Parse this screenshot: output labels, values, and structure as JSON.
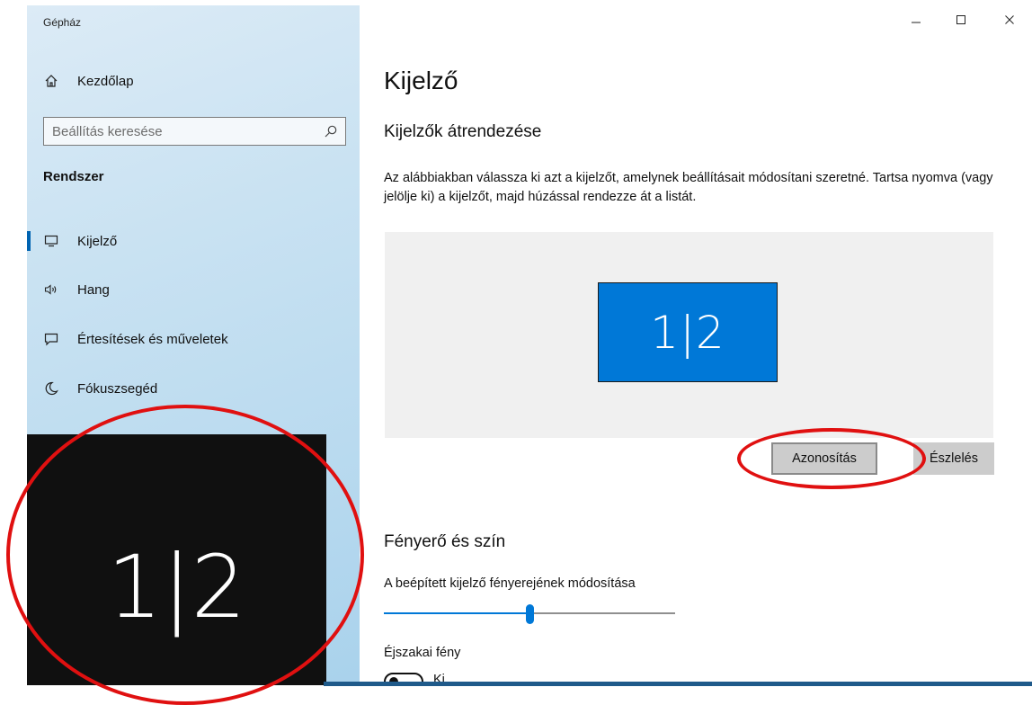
{
  "window": {
    "title": "Gépház",
    "controls": {
      "minimize": "–",
      "maximize": "☐",
      "close": "✕"
    }
  },
  "sidebar": {
    "home_label": "Kezdőlap",
    "search": {
      "placeholder": "Beállítás keresése",
      "value": ""
    },
    "section": "Rendszer",
    "items": [
      {
        "label": "Kijelző",
        "icon": "monitor-icon",
        "selected": true
      },
      {
        "label": "Hang",
        "icon": "speaker-icon"
      },
      {
        "label": "Értesítések és műveletek",
        "icon": "notification-icon"
      },
      {
        "label": "Fókuszsegéd",
        "icon": "moon-icon"
      }
    ]
  },
  "main": {
    "title": "Kijelző",
    "arrange": {
      "heading": "Kijelzők átrendezése",
      "description": "Az alábbiakban válassza ki azt a kijelzőt, amelynek beállításait módosítani szeretné. Tartsa nyomva (vagy jelölje ki) a kijelzőt, majd húzással rendezze át a listát.",
      "monitor_label": "1|2",
      "identify_button": "Azonosítás",
      "detect_button": "Észlelés"
    },
    "brightness": {
      "heading": "Fényerő és szín",
      "label": "A beépített kijelző fényerejének módosítása",
      "value": 0.5
    },
    "night_light": {
      "label": "Éjszakai fény",
      "state": "Ki"
    }
  },
  "overlay": {
    "label": "1|2"
  },
  "colors": {
    "accent": "#0078d7",
    "annotation": "#e01010",
    "overlay_bg": "#101010"
  }
}
